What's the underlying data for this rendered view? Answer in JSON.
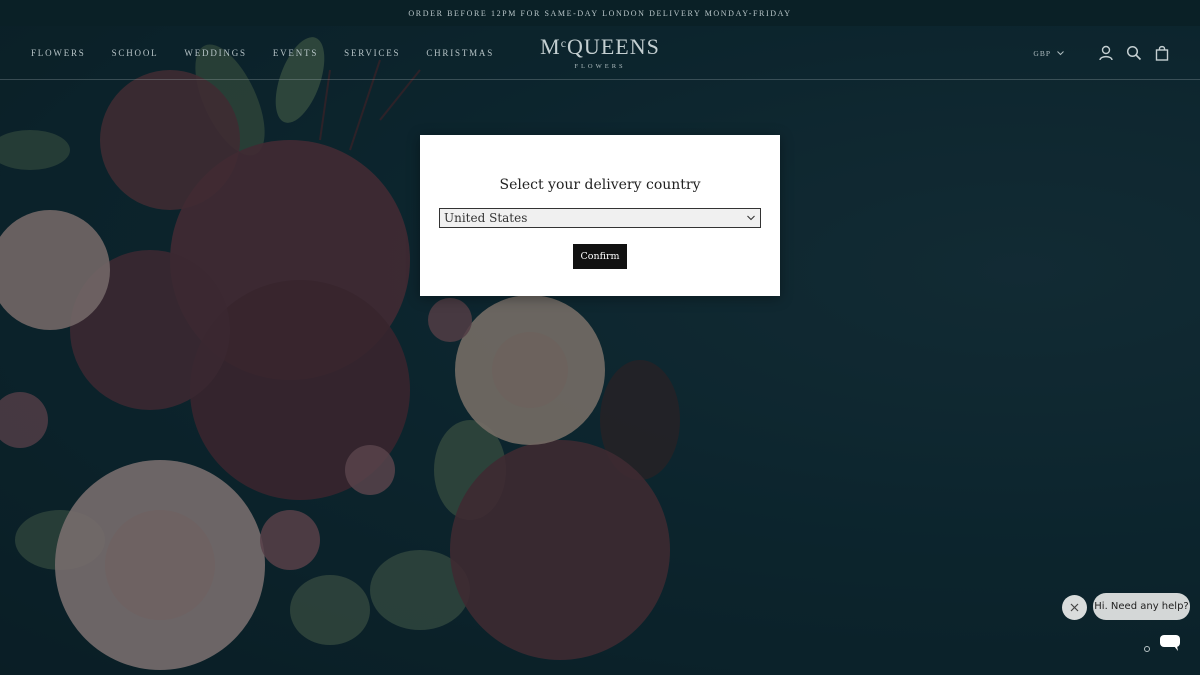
{
  "announcement": "ORDER BEFORE 12PM FOR SAME-DAY LONDON DELIVERY MONDAY-FRIDAY",
  "nav": {
    "items": [
      "FLOWERS",
      "SCHOOL",
      "WEDDINGS",
      "EVENTS",
      "SERVICES",
      "CHRISTMAS"
    ]
  },
  "logo": {
    "main_before": "M",
    "main_sup": "c",
    "main_after": "QUEENS",
    "sub": "FLOWERS"
  },
  "header_right": {
    "currency": "GBP",
    "icons": [
      "account-icon",
      "search-icon",
      "cart-icon"
    ]
  },
  "modal": {
    "title": "Select your delivery country",
    "select_value": "United States",
    "confirm_label": "Confirm"
  },
  "chat": {
    "bubble_text": "Hi. Need any help?",
    "icons": [
      "close-icon",
      "chat-icon"
    ]
  },
  "colors": {
    "background": "#0e2a33",
    "announcement_bar": "#0a2026",
    "modal_bg": "#ffffff",
    "button_bg": "#111111"
  }
}
